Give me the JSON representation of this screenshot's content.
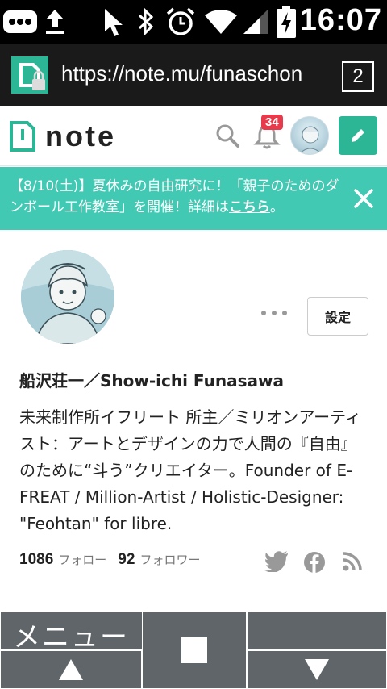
{
  "status_bar": {
    "time": "16:07",
    "icons": [
      "notification-dots-icon",
      "upload-icon",
      "cursor-icon",
      "bluetooth-icon",
      "alarm-icon",
      "wifi-icon",
      "signal-icon",
      "battery-charging-icon"
    ]
  },
  "browser": {
    "url": "https://note.mu/funaschon",
    "tab_count": "2"
  },
  "header": {
    "logo_text": "note",
    "notification_count": "34",
    "accent_color": "#2cb696"
  },
  "banner": {
    "text_before_link": "【8/10(土)】夏休みの自由研究に！「親子のためのダンボール工作教室」を開催！詳細は",
    "link_text": "こちら",
    "text_after_link": "。",
    "background_color": "#41c9b4"
  },
  "profile": {
    "name": "船沢荘一／Show-ichi Funasawa",
    "settings_label": "設定",
    "bio": "未来制作所イフリート 所主／ミリオンアーティスト：アートとデザインの力で人間の『自由』のために“斗う”クリエイター。Founder of E-FREAT / Million-Artist / Holistic-Designer: \"Feohtan\" for libre.",
    "following_count": "1086",
    "following_label": "フォロー",
    "followers_count": "92",
    "followers_label": "フォロワー"
  },
  "bottom_menu": {
    "menu_label": "メニュー"
  }
}
